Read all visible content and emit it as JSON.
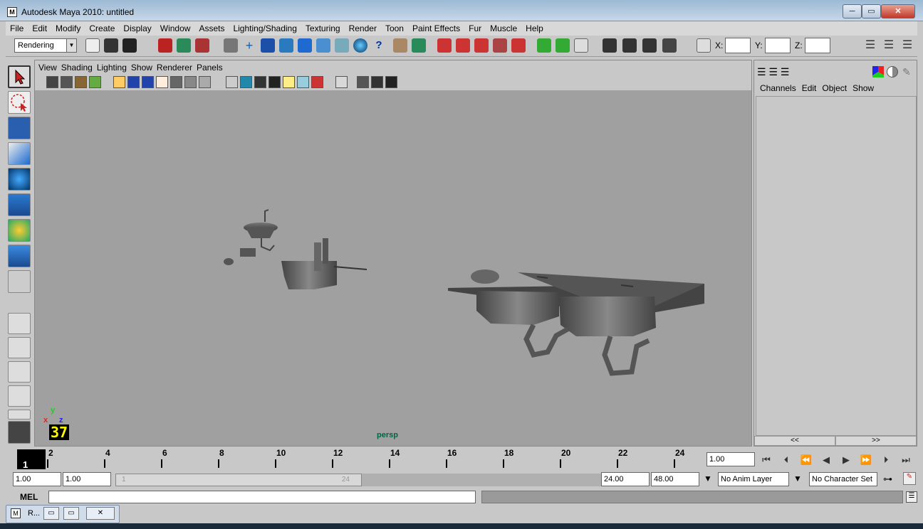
{
  "window": {
    "title": "Autodesk Maya 2010: untitled",
    "app_icon": "maya-icon"
  },
  "caption_buttons": {
    "minimize": "─",
    "maximize": "▭",
    "close": "✕"
  },
  "menubar": [
    "File",
    "Edit",
    "Modify",
    "Create",
    "Display",
    "Window",
    "Assets",
    "Lighting/Shading",
    "Texturing",
    "Render",
    "Toon",
    "Paint Effects",
    "Fur",
    "Muscle",
    "Help"
  ],
  "status_line": {
    "mode": "Rendering",
    "x_label": "X:",
    "y_label": "Y:",
    "z_label": "Z:"
  },
  "panel_menu": [
    "View",
    "Shading",
    "Lighting",
    "Show",
    "Renderer",
    "Panels"
  ],
  "viewport": {
    "camera_label": "persp",
    "axis": {
      "x": "x",
      "y": "y",
      "z": "z"
    },
    "fps_display": "37"
  },
  "channel_box": {
    "menu": [
      "Channels",
      "Edit",
      "Object",
      "Show"
    ],
    "scroll_left": "<<",
    "scroll_right": ">>"
  },
  "timeline": {
    "current_frame_box": "1",
    "ticks": [
      "2",
      "4",
      "6",
      "8",
      "10",
      "12",
      "14",
      "16",
      "18",
      "20",
      "22",
      "24"
    ],
    "current_frame_field": "1.00"
  },
  "range": {
    "start_time": "1.00",
    "playback_start": "1.00",
    "slider_start": "1",
    "slider_end": "24",
    "playback_end": "24.00",
    "end_time": "48.00",
    "anim_layer": "No Anim Layer",
    "character_set": "No Character Set"
  },
  "command_line": {
    "label": "MEL"
  },
  "minimized_window": {
    "label": "R..."
  }
}
